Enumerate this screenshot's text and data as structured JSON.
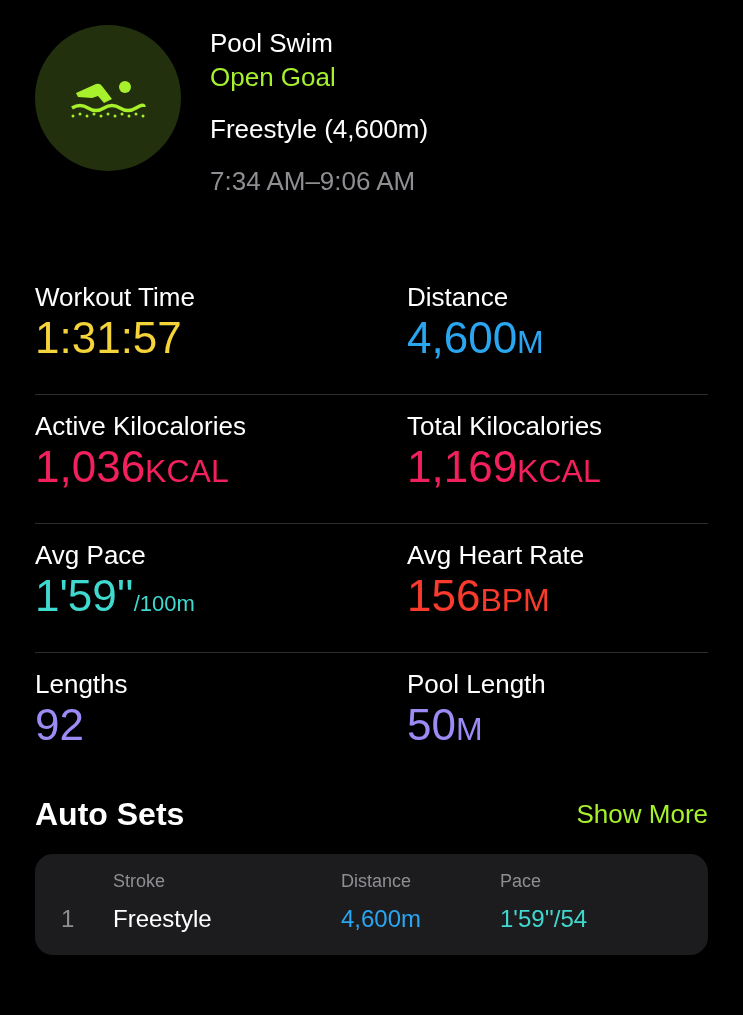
{
  "header": {
    "title": "Pool Swim",
    "goal": "Open Goal",
    "stroke_summary": "Freestyle (4,600m)",
    "time_range": "7:34 AM–9:06 AM"
  },
  "metrics": [
    {
      "kind": "plain",
      "label": "Workout Time",
      "value": "1:31:57",
      "color": "#f5d33b"
    },
    {
      "kind": "caps",
      "label": "Distance",
      "value": "4,600",
      "unit": "M",
      "color": "#2aa6f0"
    },
    {
      "kind": "caps",
      "label": "Active Kilocalories",
      "value": "1,036",
      "unit": "KCAL",
      "color": "#f2205c"
    },
    {
      "kind": "caps",
      "label": "Total Kilocalories",
      "value": "1,169",
      "unit": "KCAL",
      "color": "#f2205c"
    },
    {
      "kind": "small",
      "label": "Avg Pace",
      "value": "1'59''",
      "unit": "/100m",
      "color": "#3fd9cf"
    },
    {
      "kind": "caps",
      "label": "Avg Heart Rate",
      "value": "156",
      "unit": "BPM",
      "color": "#fa3a2c"
    },
    {
      "kind": "plain",
      "label": "Lengths",
      "value": "92",
      "color": "#9b8cf5"
    },
    {
      "kind": "caps",
      "label": "Pool Length",
      "value": "50",
      "unit": "M",
      "color": "#9b8cf5"
    }
  ],
  "auto_sets": {
    "title": "Auto Sets",
    "show_more": "Show More",
    "columns": [
      "Stroke",
      "Distance",
      "Pace"
    ],
    "rows": [
      {
        "index": "1",
        "stroke": "Freestyle",
        "distance": "4,600m",
        "pace": "1'59''/54"
      }
    ]
  }
}
